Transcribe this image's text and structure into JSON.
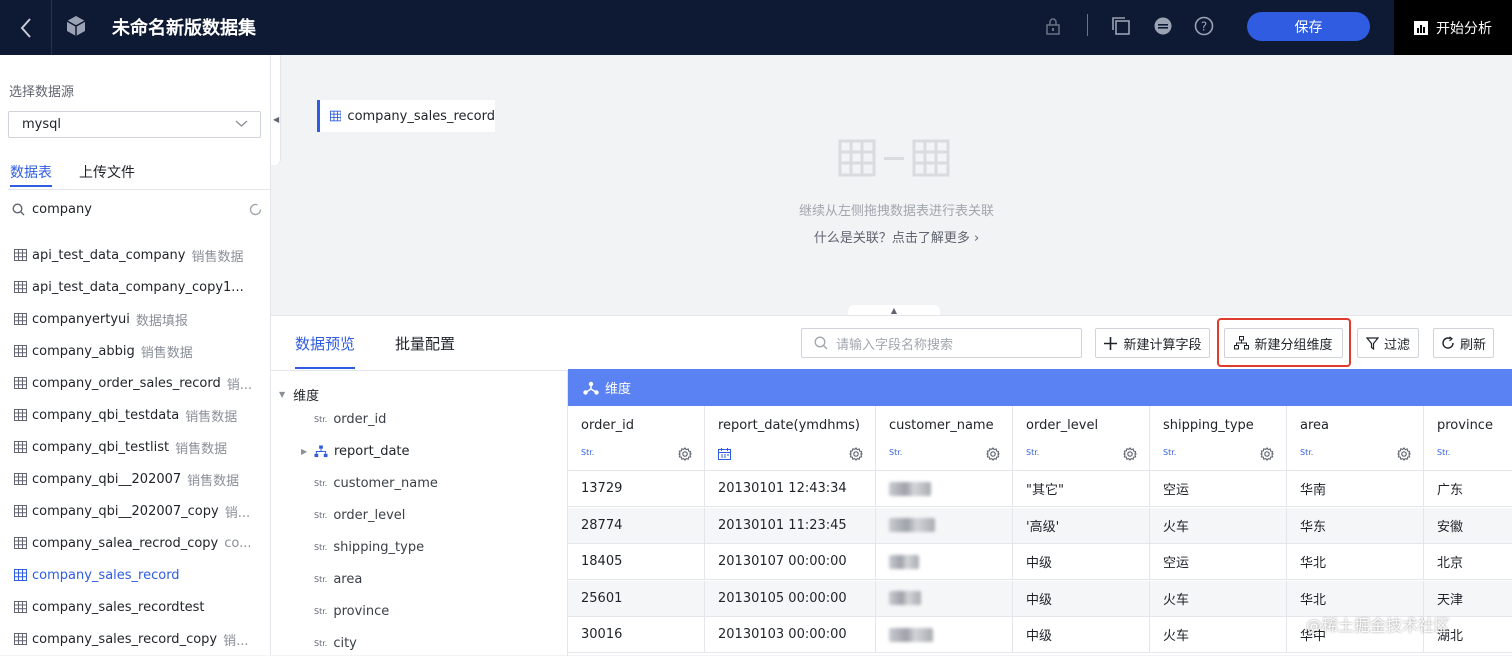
{
  "header": {
    "title": "未命名新版数据集",
    "save_label": "保存",
    "analyze_label": "开始分析"
  },
  "sidebar": {
    "source_label": "选择数据源",
    "source_value": "mysql",
    "tabs": [
      "数据表",
      "上传文件"
    ],
    "search_value": "company",
    "items": [
      {
        "name": "api_test_data_company",
        "tag": "销售数据"
      },
      {
        "name": "api_test_data_company_copy1...",
        "tag": ""
      },
      {
        "name": "companyertyui",
        "tag": "数据填报"
      },
      {
        "name": "company_abbig",
        "tag": "销售数据"
      },
      {
        "name": "company_order_sales_record",
        "tag": "销..."
      },
      {
        "name": "company_qbi_testdata",
        "tag": "销售数据"
      },
      {
        "name": "company_qbi_testlist",
        "tag": "销售数据"
      },
      {
        "name": "company_qbi__202007",
        "tag": "销售数据"
      },
      {
        "name": "company_qbi__202007_copy",
        "tag": "销..."
      },
      {
        "name": "company_salea_recrod_copy",
        "tag": "co..."
      },
      {
        "name": "company_sales_record",
        "tag": ""
      },
      {
        "name": "company_sales_recordtest",
        "tag": ""
      },
      {
        "name": "company_sales_record_copy",
        "tag": "销..."
      }
    ],
    "active_index": 10
  },
  "canvas": {
    "node_label": "company_sales_record",
    "hint_primary": "继续从左侧拖拽数据表进行表关联",
    "hint_secondary": "什么是关联？点击了解更多"
  },
  "panel": {
    "tabs": [
      "数据预览",
      "批量配置"
    ],
    "search_placeholder": "请输入字段名称搜索",
    "buttons": {
      "new_calc_field": "新建计算字段",
      "new_group_dim": "新建分组维度",
      "filter": "过滤",
      "refresh": "刷新"
    }
  },
  "tree": {
    "root_label": "维度",
    "type_badge": "Str.",
    "fields": [
      "order_id",
      "report_date",
      "customer_name",
      "order_level",
      "shipping_type",
      "area",
      "province",
      "city"
    ]
  },
  "grid": {
    "group_label": "维度",
    "columns": [
      {
        "name": "order_id",
        "type": "Str."
      },
      {
        "name": "report_date(ymdhms)",
        "type": "date"
      },
      {
        "name": "customer_name",
        "type": "Str."
      },
      {
        "name": "order_level",
        "type": "Str."
      },
      {
        "name": "shipping_type",
        "type": "Str."
      },
      {
        "name": "area",
        "type": "Str."
      },
      {
        "name": "province",
        "type": "Str."
      }
    ],
    "rows": [
      [
        "13729",
        "20130101 12:43:34",
        "",
        "\"其它\"",
        "空运",
        "华南",
        "广东"
      ],
      [
        "28774",
        "20130101 11:23:45",
        "",
        "'高级'",
        "火车",
        "华东",
        "安徽"
      ],
      [
        "18405",
        "20130107 00:00:00",
        "",
        "中级",
        "空运",
        "华北",
        "北京"
      ],
      [
        "25601",
        "20130105 00:00:00",
        "",
        "中级",
        "火车",
        "华北",
        "天津"
      ],
      [
        "30016",
        "20130103 00:00:00",
        "",
        "中级",
        "火车",
        "华中",
        "湖北"
      ]
    ]
  },
  "watermark": "@稀土掘金技术社区",
  "colors": {
    "accent": "#2f5ce0",
    "topbar": "#0e1a33",
    "grid_header": "#5b82f3",
    "highlight": "#e03a2f"
  }
}
